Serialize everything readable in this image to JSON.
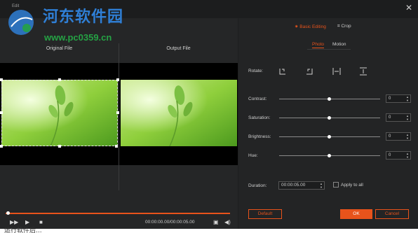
{
  "window": {
    "title": "Edit",
    "close_icon": "close-icon"
  },
  "watermark": {
    "title": "河东软件园",
    "url": "www.pc0359.cn"
  },
  "preview": {
    "original_label": "Original File",
    "output_label": "Output File"
  },
  "player": {
    "time": "00:00:00.00/00:00:05.00",
    "progress": 0.0
  },
  "tabs": {
    "basic": "Basic Editing",
    "crop": "Crop"
  },
  "subtabs": {
    "photo": "Photo",
    "motion": "Motion"
  },
  "rotate": {
    "label": "Rotate:"
  },
  "adjust": [
    {
      "label": "Contrast:",
      "value": "0"
    },
    {
      "label": "Saturation:",
      "value": "0"
    },
    {
      "label": "Brightness:",
      "value": "0"
    },
    {
      "label": "Hue:",
      "value": "0"
    }
  ],
  "duration": {
    "label": "Duration:",
    "value": "00:00:05.00",
    "apply_all": "Apply to all"
  },
  "buttons": {
    "default": "Default",
    "ok": "OK",
    "cancel": "Cancel"
  },
  "bottom_strip": {
    "text": "运行软件后..."
  },
  "colors": {
    "accent": "#e8531b",
    "bg": "#1e1f20"
  }
}
